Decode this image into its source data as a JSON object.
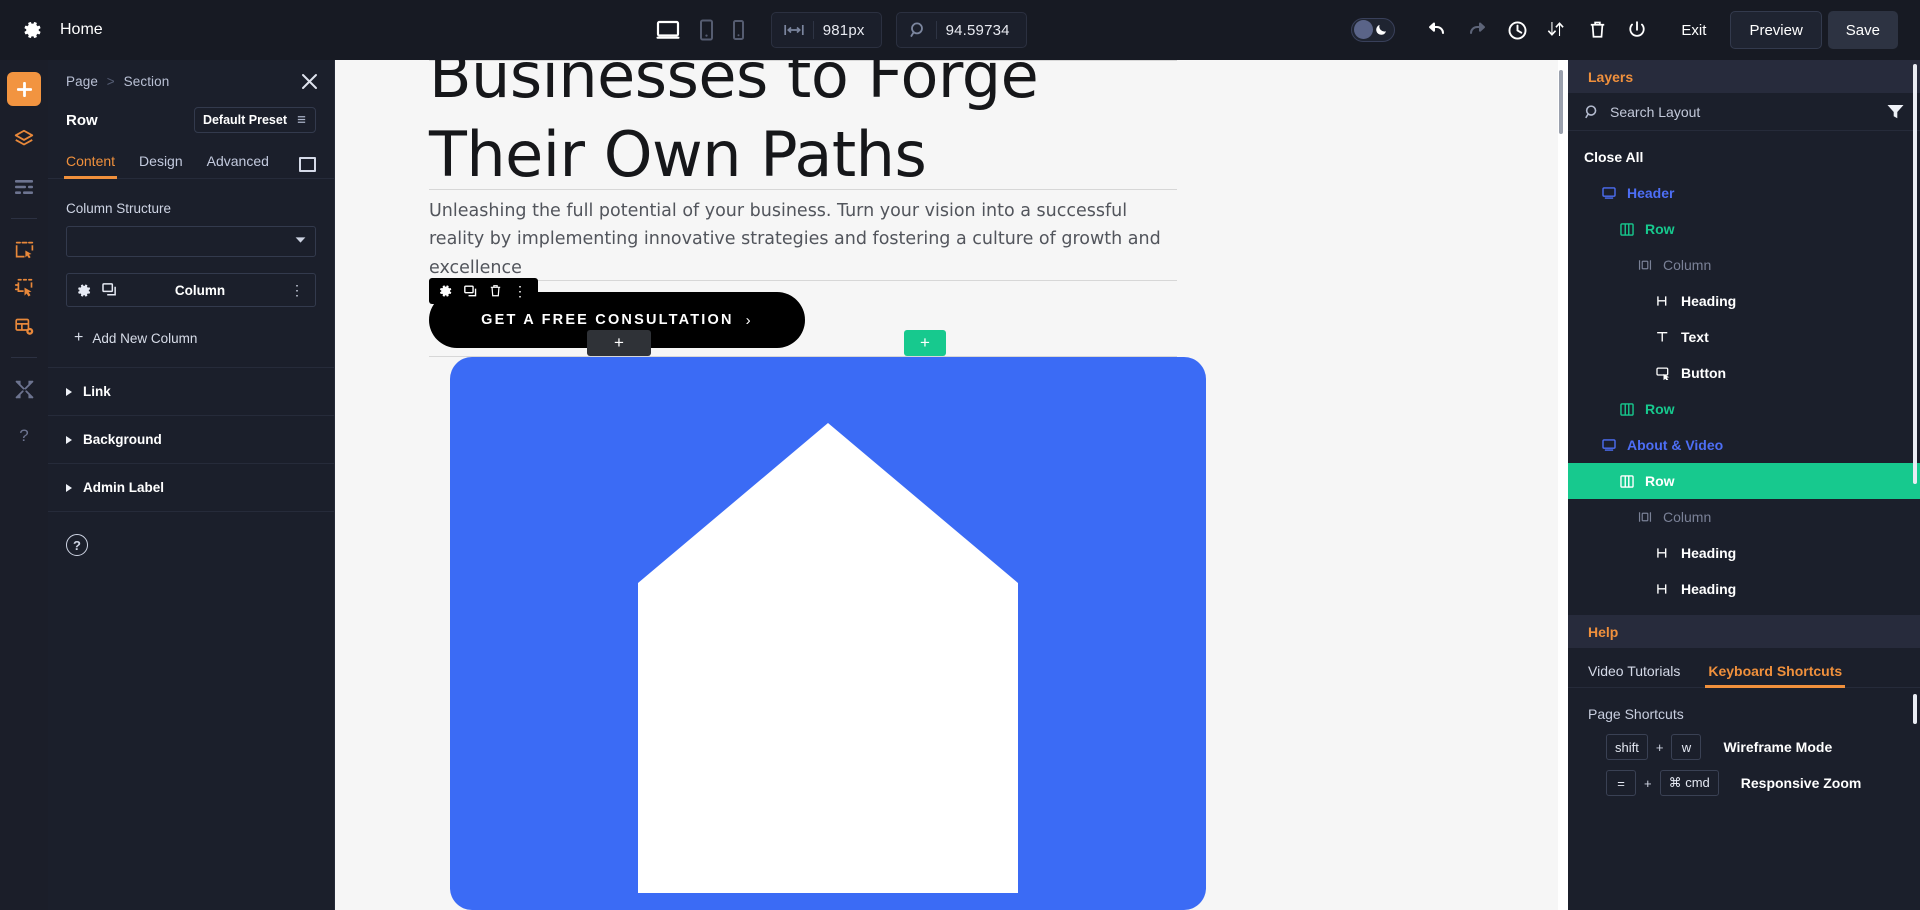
{
  "topbar": {
    "gear_icon": "gear-icon",
    "page_name": "Home",
    "devices": [
      {
        "name": "desktop",
        "icon": "desktop-icon",
        "active": true
      },
      {
        "name": "tablet",
        "icon": "tablet-icon",
        "active": false
      },
      {
        "name": "phone",
        "icon": "phone-icon",
        "active": false
      }
    ],
    "width_icon": "horizontal-resize-icon",
    "width_value": "981px",
    "zoom_icon": "zoom-icon",
    "zoom_value": "94.59734",
    "dark_toggle_icon": "moon-icon",
    "undo_icon": "undo-icon",
    "redo_icon": "redo-icon",
    "history_icon": "clock-icon",
    "portability_icon": "sort-updown-icon",
    "trash_icon": "trash-icon",
    "power_icon": "power-icon",
    "exit_label": "Exit",
    "preview_label": "Preview",
    "save_label": "Save"
  },
  "rail": {
    "items": [
      {
        "name": "add-icon",
        "label": "Add"
      },
      {
        "name": "layers-stack-icon",
        "label": "Layers"
      },
      {
        "name": "list-icon",
        "label": "List"
      },
      {
        "name": "clickable-area-icon",
        "label": "Hover"
      },
      {
        "name": "clickable-area-2-icon",
        "label": "Click"
      },
      {
        "name": "layout-settings-icon",
        "label": "Layout"
      },
      {
        "name": "tools-icon",
        "label": "Tools"
      },
      {
        "name": "question-icon",
        "label": "Help"
      }
    ]
  },
  "settings": {
    "breadcrumb": {
      "parent": "Page",
      "separator": ">",
      "current": "Section"
    },
    "close_icon": "close-icon",
    "title": "Row",
    "preset_label": "Default Preset",
    "preset_icon": "preset-icon",
    "tabs": [
      {
        "label": "Content",
        "active": true
      },
      {
        "label": "Design",
        "active": false
      },
      {
        "label": "Advanced",
        "active": false
      }
    ],
    "expand_icon": "expand-panel-icon",
    "column_structure_label": "Column Structure",
    "column_structure_value": "",
    "column_item": {
      "gear_icon": "gear-icon",
      "duplicate_icon": "duplicate-icon",
      "label": "Column",
      "more_icon": "more-vertical-icon"
    },
    "add_new_column_label": "Add New Column",
    "accordions": [
      {
        "label": "Link"
      },
      {
        "label": "Background"
      },
      {
        "label": "Admin Label"
      }
    ],
    "help_icon": "question-circle-icon"
  },
  "canvas": {
    "heading_line1": "Businesses to Forge",
    "heading_line2": "Their Own Paths",
    "paragraph": "Unleashing the full potential of your business. Turn your vision into a successful reality by implementing innovative strategies and fostering a culture of growth and excellence",
    "cta_label": "GET A FREE CONSULTATION",
    "cta_chevron": "›",
    "element_toolbar": [
      {
        "name": "gear-icon"
      },
      {
        "name": "duplicate-icon"
      },
      {
        "name": "trash-icon"
      },
      {
        "name": "more-vertical-icon"
      }
    ],
    "add_module_dark": "+",
    "add_module_green": "+",
    "house_graphic": "house-icon"
  },
  "layers": {
    "tab_label": "Layers",
    "search_icon": "search-icon",
    "search_placeholder": "Search Layout",
    "search_value": "",
    "filter_icon": "filter-icon",
    "items": [
      {
        "label": "Close All",
        "type": "closeall",
        "icon": "",
        "indent": 0
      },
      {
        "label": "Header",
        "type": "section",
        "icon": "section-icon",
        "indent": 1
      },
      {
        "label": "Row",
        "type": "rowr",
        "icon": "row-icon",
        "indent": 2
      },
      {
        "label": "Column",
        "type": "column",
        "icon": "column-icon",
        "indent": 3
      },
      {
        "label": "Heading",
        "type": "module",
        "icon": "heading-icon",
        "indent": 4
      },
      {
        "label": "Text",
        "type": "module",
        "icon": "text-icon",
        "indent": 4
      },
      {
        "label": "Button",
        "type": "module",
        "icon": "button-icon",
        "indent": 4
      },
      {
        "label": "Row",
        "type": "rowr",
        "icon": "row-icon",
        "indent": 2
      },
      {
        "label": "About & Video",
        "type": "section",
        "icon": "section-icon",
        "indent": 1
      },
      {
        "label": "Row",
        "type": "selected",
        "icon": "row-icon",
        "indent": 2
      },
      {
        "label": "Column",
        "type": "column",
        "icon": "column-icon",
        "indent": 3
      },
      {
        "label": "Heading",
        "type": "module",
        "icon": "heading-icon",
        "indent": 4
      },
      {
        "label": "Heading",
        "type": "module",
        "icon": "heading-icon",
        "indent": 4
      }
    ]
  },
  "help": {
    "tab_label": "Help",
    "subtabs": [
      {
        "label": "Video Tutorials",
        "active": false
      },
      {
        "label": "Keyboard Shortcuts",
        "active": true
      }
    ],
    "section_title": "Page Shortcuts",
    "shortcuts": [
      {
        "keys": [
          "shift",
          "w"
        ],
        "plus": "+",
        "desc": "Wireframe Mode"
      },
      {
        "keys": [
          "=",
          "⌘ cmd"
        ],
        "plus": "+",
        "desc": "Responsive Zoom"
      }
    ]
  },
  "colors": {
    "accent_orange": "#f0903c",
    "accent_green": "#17c98e",
    "accent_blue": "#4d6ef5",
    "panel_bg": "#1b1f2b",
    "topbar_bg": "#171a23",
    "card_blue": "#3b6bf5"
  }
}
